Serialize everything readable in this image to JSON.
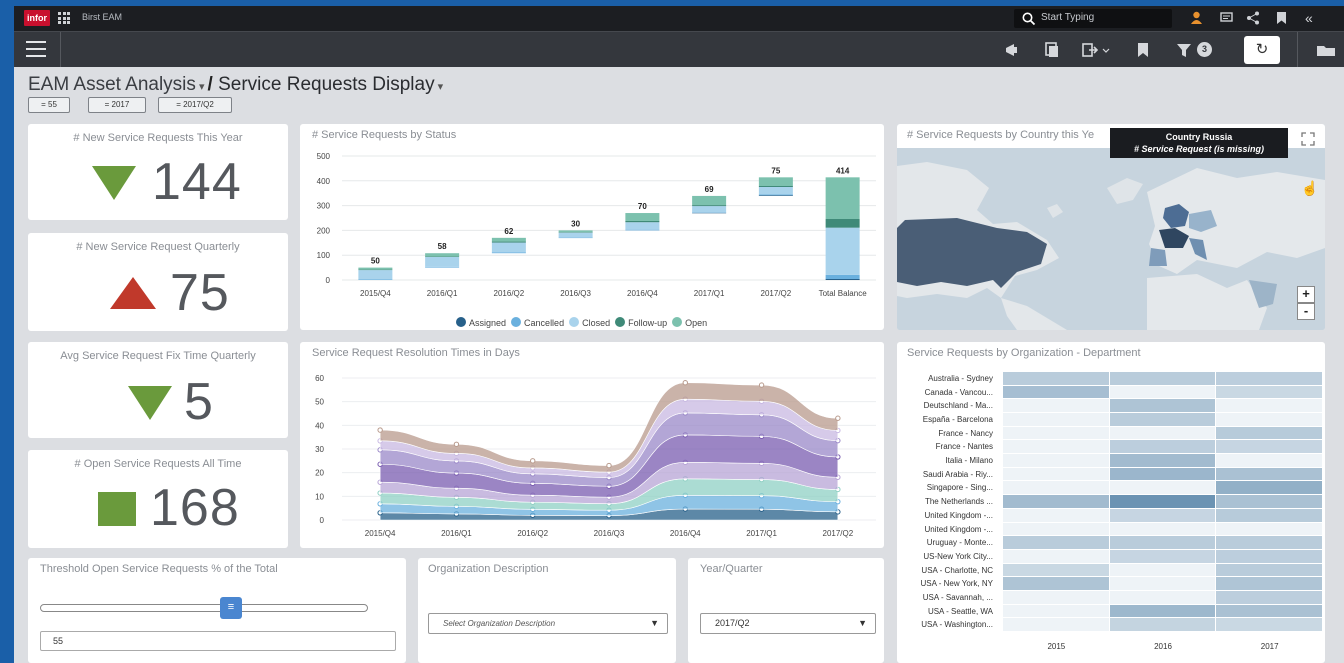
{
  "app": {
    "logo": "infor",
    "name": "Birst EAM"
  },
  "search": {
    "placeholder": "Start Typing"
  },
  "toolbar": {
    "filter_count": "3"
  },
  "page": {
    "title_part1": "EAM Asset Analysis",
    "title_sep": "/",
    "title_part2": "Service Requests Display"
  },
  "filters": [
    "= 55",
    "= 2017",
    "= 2017/Q2"
  ],
  "kpis": [
    {
      "title": "# New Service Requests This Year",
      "value": "144",
      "indicator": "down-triangle",
      "color": "#6a9a3c"
    },
    {
      "title": "# New Service Request Quarterly",
      "value": "75",
      "indicator": "up-triangle",
      "color": "#c0392b"
    },
    {
      "title": "Avg Service Request Fix Time Quarterly",
      "value": "5",
      "indicator": "down-triangle",
      "color": "#6a9a3c"
    },
    {
      "title": "# Open Service Requests All Time",
      "value": "168",
      "indicator": "square",
      "color": "#6a9a3c"
    }
  ],
  "status_chart": {
    "title": "# Service Requests by Status",
    "legend": [
      {
        "name": "Assigned",
        "color": "#27608a"
      },
      {
        "name": "Cancelled",
        "color": "#6ab0de"
      },
      {
        "name": "Closed",
        "color": "#a9d3ec"
      },
      {
        "name": "Follow-up",
        "color": "#3f8a78"
      },
      {
        "name": "Open",
        "color": "#7cc1ae"
      }
    ]
  },
  "resolution_chart": {
    "title": "Service Request Resolution Times in Days"
  },
  "map_card": {
    "title": "# Service Requests by Country this Ye",
    "tooltip_line1": "Country Russia",
    "tooltip_line2": "# Service Request (is missing)",
    "zoom_in": "+",
    "zoom_out": "-"
  },
  "heatmap_card": {
    "title": "Service Requests by Organization - Department",
    "rows": [
      "Australia - Sydney",
      "Canada - Vancou...",
      "Deutschland - Ma...",
      "España - Barcelona",
      "France - Nancy",
      "France - Nantes",
      "Italia - Milano",
      "Saudi Arabia - Riy...",
      "Singapore - Sing...",
      "The Netherlands ...",
      "United Kingdom -...",
      "United Kingdom -...",
      "Uruguay - Monte...",
      "US-New York City...",
      "USA - Charlotte, NC",
      "USA - New York, NY",
      "USA - Savannah, ...",
      "USA - Seattle, WA",
      "USA - Washington..."
    ],
    "cols": [
      "2015",
      "2016",
      "2017"
    ],
    "intensity": [
      [
        0.3,
        0.3,
        0.28
      ],
      [
        0.42,
        0.0,
        0.2
      ],
      [
        0.0,
        0.38,
        0.0
      ],
      [
        0.0,
        0.3,
        0.0
      ],
      [
        0.0,
        0.0,
        0.32
      ],
      [
        0.0,
        0.28,
        0.22
      ],
      [
        0.0,
        0.45,
        0.0
      ],
      [
        0.0,
        0.5,
        0.4
      ],
      [
        0.0,
        0.0,
        0.55
      ],
      [
        0.45,
        0.8,
        0.4
      ],
      [
        0.0,
        0.22,
        0.32
      ],
      [
        0.0,
        0.0,
        0.0
      ],
      [
        0.3,
        0.3,
        0.3
      ],
      [
        0.0,
        0.22,
        0.28
      ],
      [
        0.2,
        0.0,
        0.3
      ],
      [
        0.38,
        0.0,
        0.36
      ],
      [
        0.0,
        0.0,
        0.28
      ],
      [
        0.0,
        0.48,
        0.4
      ],
      [
        0.0,
        0.24,
        0.2
      ]
    ]
  },
  "threshold_card": {
    "title": "Threshold Open Service Requests % of the Total",
    "value": "55",
    "slider_level": 0.55
  },
  "org_card": {
    "title": "Organization Description",
    "placeholder": "Select Organization Description"
  },
  "yq_card": {
    "title": "Year/Quarter",
    "selected": "2017/Q2"
  },
  "chart_data": [
    {
      "type": "bar",
      "title": "# Service Requests by Status",
      "categories": [
        "2015/Q4",
        "2016/Q1",
        "2016/Q2",
        "2016/Q3",
        "2016/Q4",
        "2017/Q1",
        "2017/Q2",
        "Total Balance"
      ],
      "totals": [
        50,
        58,
        62,
        30,
        70,
        69,
        75,
        414
      ],
      "bar_ranges": [
        [
          0,
          50
        ],
        [
          50,
          108
        ],
        [
          108,
          170
        ],
        [
          170,
          200
        ],
        [
          200,
          270
        ],
        [
          270,
          339
        ],
        [
          339,
          414
        ],
        [
          0,
          414
        ]
      ],
      "ylim": [
        0,
        500
      ],
      "yticks": [
        0,
        100,
        200,
        300,
        400,
        500
      ],
      "legend_position": "bottom",
      "series": [
        {
          "name": "Assigned",
          "values": [
            0,
            0,
            0,
            0,
            0,
            1,
            3,
            4
          ]
        },
        {
          "name": "Cancelled",
          "values": [
            2,
            3,
            3,
            1,
            3,
            2,
            3,
            17
          ]
        },
        {
          "name": "Closed",
          "values": [
            38,
            40,
            40,
            20,
            30,
            25,
            30,
            190
          ]
        },
        {
          "name": "Follow-up",
          "values": [
            2,
            2,
            4,
            2,
            5,
            4,
            4,
            35
          ]
        },
        {
          "name": "Open",
          "values": [
            8,
            13,
            15,
            7,
            32,
            37,
            35,
            168
          ]
        }
      ]
    },
    {
      "type": "area",
      "title": "Service Request Resolution Times in Days",
      "categories": [
        "2015/Q4",
        "2016/Q1",
        "2016/Q2",
        "2016/Q3",
        "2016/Q4",
        "2017/Q1",
        "2017/Q2"
      ],
      "ylim": [
        0,
        60
      ],
      "yticks": [
        0,
        10,
        20,
        30,
        40,
        50,
        60
      ],
      "stack_totals": [
        38,
        32,
        25,
        23,
        58,
        57,
        43
      ]
    }
  ]
}
